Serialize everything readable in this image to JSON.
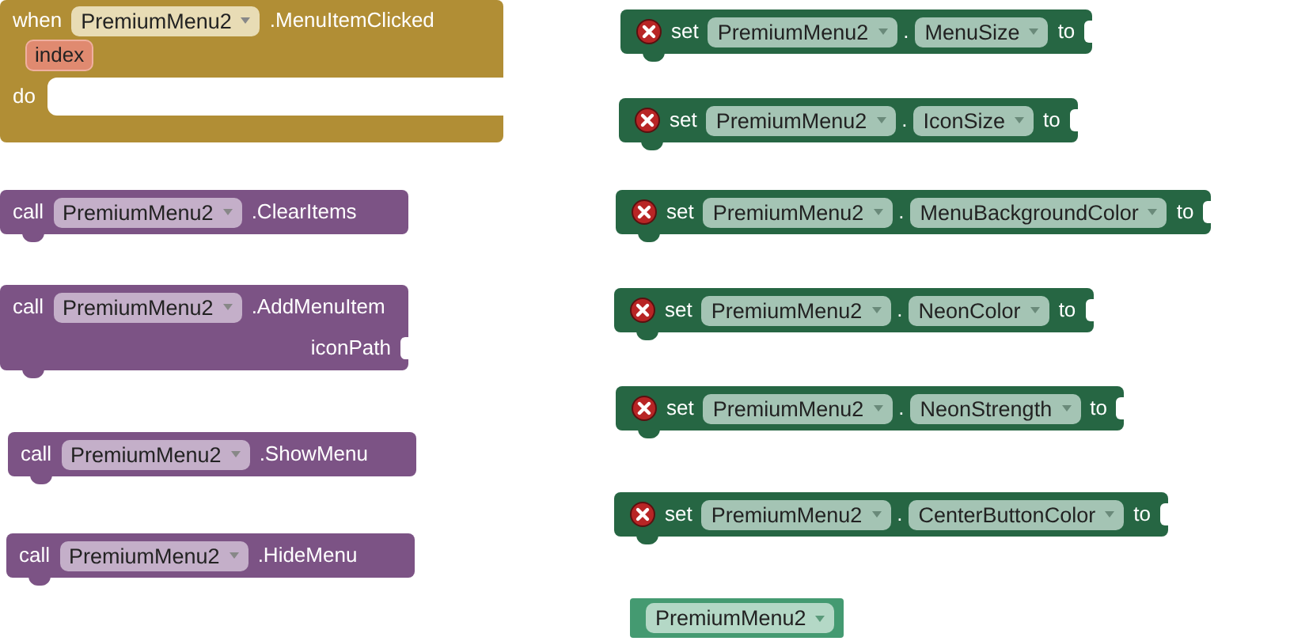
{
  "event_block": {
    "keyword": "when",
    "component": "PremiumMenu2",
    "event": ".MenuItemClicked",
    "parameter": "index",
    "do_label": "do"
  },
  "blocks": [
    {
      "kind": "call",
      "keyword": "call",
      "component": "PremiumMenu2",
      "method": ".ClearItems"
    },
    {
      "kind": "call",
      "keyword": "call",
      "component": "PremiumMenu2",
      "method": ".AddMenuItem",
      "argument": "iconPath"
    },
    {
      "kind": "call",
      "keyword": "call",
      "component": "PremiumMenu2",
      "method": ".ShowMenu"
    },
    {
      "kind": "call",
      "keyword": "call",
      "component": "PremiumMenu2",
      "method": ".HideMenu"
    },
    {
      "kind": "setter",
      "keyword": "set",
      "component": "PremiumMenu2",
      "dot": ".",
      "property": "MenuSize",
      "to_label": "to"
    },
    {
      "kind": "setter",
      "keyword": "set",
      "component": "PremiumMenu2",
      "dot": ".",
      "property": "IconSize",
      "to_label": "to"
    },
    {
      "kind": "setter",
      "keyword": "set",
      "component": "PremiumMenu2",
      "dot": ".",
      "property": "MenuBackgroundColor",
      "to_label": "to"
    },
    {
      "kind": "setter",
      "keyword": "set",
      "component": "PremiumMenu2",
      "dot": ".",
      "property": "NeonColor",
      "to_label": "to"
    },
    {
      "kind": "setter",
      "keyword": "set",
      "component": "PremiumMenu2",
      "dot": ".",
      "property": "NeonStrength",
      "to_label": "to"
    },
    {
      "kind": "setter",
      "keyword": "set",
      "component": "PremiumMenu2",
      "dot": ".",
      "property": "CenterButtonColor",
      "to_label": "to"
    },
    {
      "kind": "getter",
      "component": "PremiumMenu2"
    }
  ]
}
